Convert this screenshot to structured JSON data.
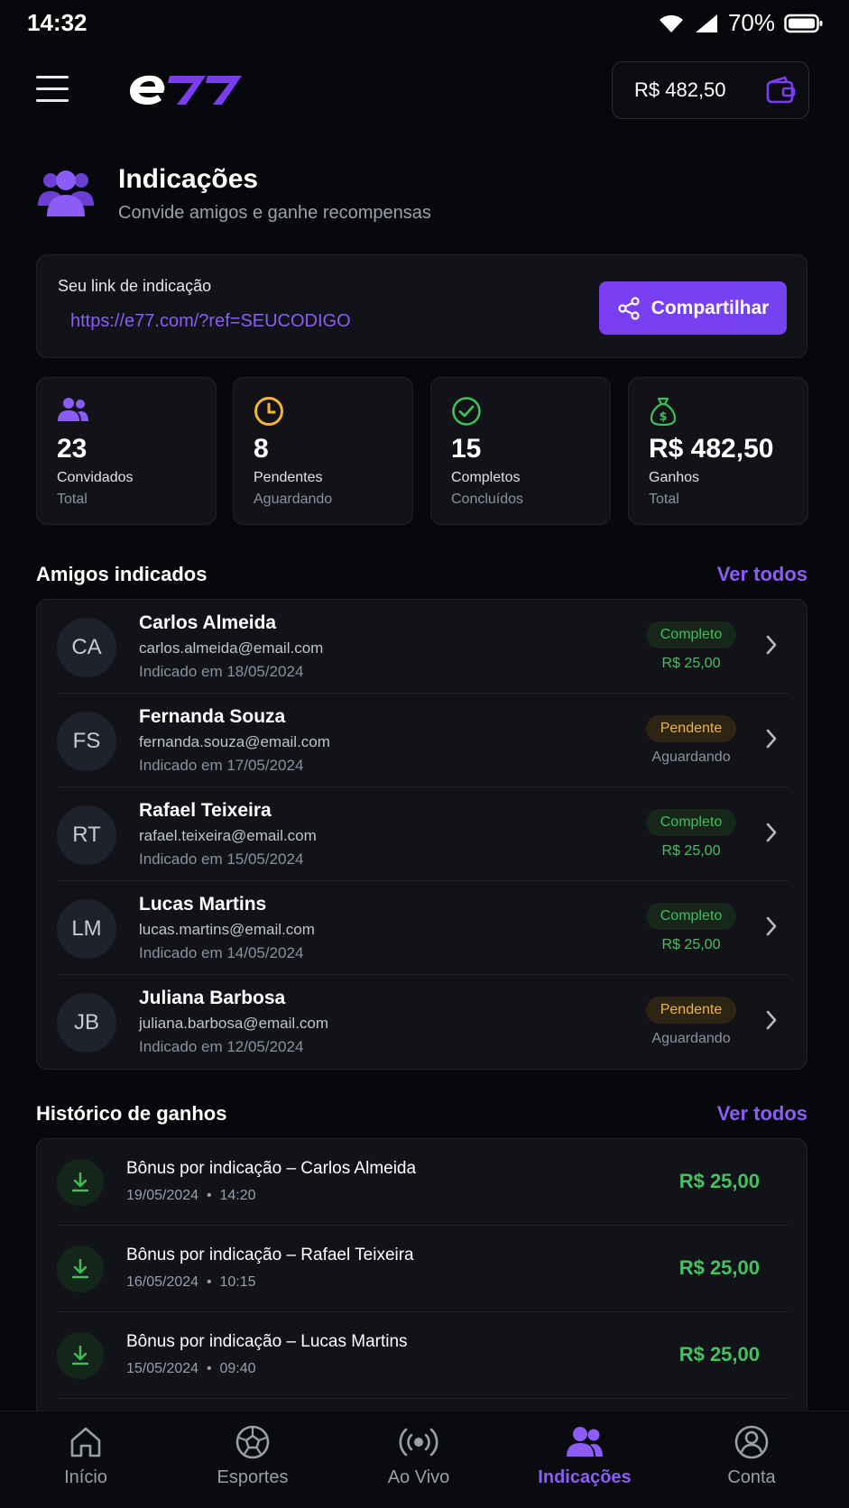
{
  "status_bar": {
    "time": "14:32",
    "battery": "70%"
  },
  "header": {
    "logo_text": "e77",
    "balance": "R$ 482,50"
  },
  "page": {
    "title": "Indicações",
    "subtitle": "Convide amigos e ganhe recompensas"
  },
  "referral": {
    "label": "Seu link de indicação",
    "url": "https://e77.com/?ref=SEUCODIGO",
    "share_label": "Compartilhar"
  },
  "stats": [
    {
      "value": "23",
      "label": "Convidados",
      "sublabel": "Total",
      "icon": "users-icon",
      "color": "#8b5cf6"
    },
    {
      "value": "8",
      "label": "Pendentes",
      "sublabel": "Aguardando",
      "icon": "clock-icon",
      "color": "#f2b53a"
    },
    {
      "value": "15",
      "label": "Completos",
      "sublabel": "Concluídos",
      "icon": "check-circle-icon",
      "color": "#3fbf58"
    },
    {
      "value": "R$ 482,50",
      "label": "Ganhos",
      "sublabel": "Total",
      "icon": "money-bag-icon",
      "color": "#3fbf58"
    }
  ],
  "friends_section": {
    "title": "Amigos indicados",
    "view_all": "Ver todos"
  },
  "friends": [
    {
      "initials": "CA",
      "name": "Carlos Almeida",
      "email": "carlos.almeida@email.com",
      "date": "Indicado em 18/05/2024",
      "status": "Completo",
      "detail": "R$ 25,00",
      "state": "complete"
    },
    {
      "initials": "FS",
      "name": "Fernanda Souza",
      "email": "fernanda.souza@email.com",
      "date": "Indicado em 17/05/2024",
      "status": "Pendente",
      "detail": "Aguardando",
      "state": "pending"
    },
    {
      "initials": "RT",
      "name": "Rafael Teixeira",
      "email": "rafael.teixeira@email.com",
      "date": "Indicado em 15/05/2024",
      "status": "Completo",
      "detail": "R$ 25,00",
      "state": "complete"
    },
    {
      "initials": "LM",
      "name": "Lucas Martins",
      "email": "lucas.martins@email.com",
      "date": "Indicado em 14/05/2024",
      "status": "Completo",
      "detail": "R$ 25,00",
      "state": "complete"
    },
    {
      "initials": "JB",
      "name": "Juliana Barbosa",
      "email": "juliana.barbosa@email.com",
      "date": "Indicado em 12/05/2024",
      "status": "Pendente",
      "detail": "Aguardando",
      "state": "pending"
    }
  ],
  "earnings_section": {
    "title": "Histórico de ganhos",
    "view_all": "Ver todos"
  },
  "earnings": [
    {
      "title": "Bônus por indicação – Carlos Almeida",
      "date": "19/05/2024",
      "time": "14:20",
      "amount": "R$ 25,00"
    },
    {
      "title": "Bônus por indicação – Rafael Teixeira",
      "date": "16/05/2024",
      "time": "10:15",
      "amount": "R$ 25,00"
    },
    {
      "title": "Bônus por indicação – Lucas Martins",
      "date": "15/05/2024",
      "time": "09:40",
      "amount": "R$ 25,00"
    }
  ],
  "bottom_nav": [
    {
      "label": "Início",
      "icon": "home-icon",
      "active": false
    },
    {
      "label": "Esportes",
      "icon": "ball-icon",
      "active": false
    },
    {
      "label": "Ao Vivo",
      "icon": "broadcast-icon",
      "active": false
    },
    {
      "label": "Indicações",
      "icon": "users-icon",
      "active": true
    },
    {
      "label": "Conta",
      "icon": "account-icon",
      "active": false
    }
  ],
  "colors": {
    "accent": "#8b5cf6",
    "success": "#3fbf58",
    "warning": "#f2b53a",
    "background": "#07080b",
    "card": "#111319"
  }
}
